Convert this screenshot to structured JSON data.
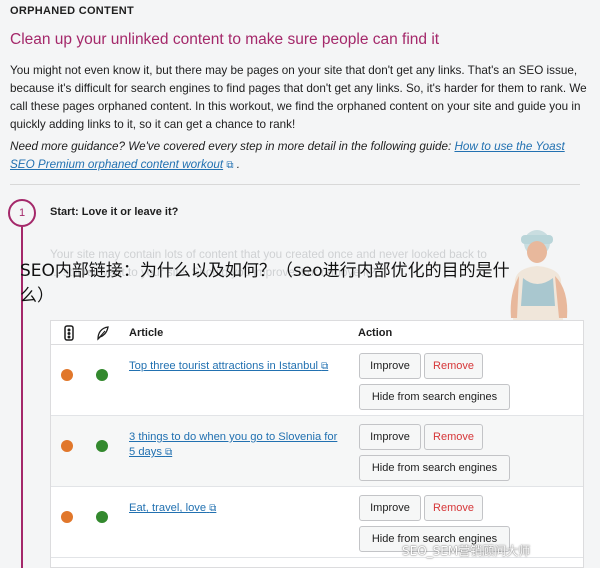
{
  "section_label": "ORPHANED CONTENT",
  "headline": "Clean up your unlinked content to make sure people can find it",
  "intro": "You might not even know it, but there may be pages on your site that don't get any links. That's an SEO issue, because it's difficult for search engines to find pages that don't get any links. So, it's harder for them to rank. We call these pages orphaned content. In this workout, we find the orphaned content on your site and guide you in quickly adding links to it, so it can get a chance to rank!",
  "guidance": {
    "text": "Need more guidance? We've covered every step in more detail in the following guide: ",
    "link_text": "How to use the Yoast SEO Premium orphaned content workout",
    "trail": " ."
  },
  "step": {
    "number": "1",
    "title": "Start: Love it or leave it?",
    "faded_text": "Your site may contain lots of content that you created once and never looked back to ... still relevant to your site. Should you improve it or remove it?"
  },
  "overlay_title": "SEO内部链接：为什么以及如何？（seo进行内部优化的目的是什么）",
  "table": {
    "col_article": "Article",
    "col_action": "Action",
    "rows": [
      {
        "article": "Top three tourist attractions in Istanbul",
        "seo_status": "orange",
        "readability_status": "green"
      },
      {
        "article": "3 things to do when you go to Slovenia for 5 days",
        "seo_status": "orange",
        "readability_status": "green"
      },
      {
        "article": "Eat, travel, love",
        "seo_status": "orange",
        "readability_status": "green"
      }
    ],
    "btn_improve": "Improve",
    "btn_remove": "Remove",
    "btn_hide": "Hide from search engines"
  },
  "watermark": "SEO_SEM营销顾问大师",
  "colors": {
    "accent": "#a4286a",
    "link": "#2271b1",
    "orange": "#e1772b",
    "green": "#33892e",
    "remove": "#d63638"
  },
  "icons": [
    "traffic-light-icon",
    "feather-icon",
    "external-link-icon"
  ]
}
